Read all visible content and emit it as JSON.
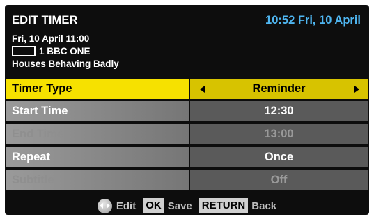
{
  "header": {
    "title": "EDIT TIMER",
    "clock": "10:52 Fri, 10 April"
  },
  "programme": {
    "datetime": "Fri, 10 April 11:00",
    "channel": "1 BBC ONE",
    "name": "Houses Behaving Badly"
  },
  "rows": [
    {
      "label": "Timer Type",
      "value": "Reminder",
      "state": "selected"
    },
    {
      "label": "Start Time",
      "value": "12:30",
      "state": "enabled"
    },
    {
      "label": "End Time",
      "value": "13:00",
      "state": "disabled"
    },
    {
      "label": "Repeat",
      "value": "Once",
      "state": "enabled"
    },
    {
      "label": "Subtitle",
      "value": "Off",
      "state": "disabled"
    }
  ],
  "footer": {
    "edit_label": "Edit",
    "ok_key": "OK",
    "save_label": "Save",
    "return_key": "RETURN",
    "back_label": "Back"
  },
  "colors": {
    "clock": "#4fb6f1",
    "selected_label_bg": "#f6e100",
    "selected_value_bg": "#d7c300"
  },
  "icons": {
    "navigation": "dpad-icon",
    "prev": "left-arrow-icon",
    "next": "right-arrow-icon",
    "channel": "channel-box-icon"
  }
}
